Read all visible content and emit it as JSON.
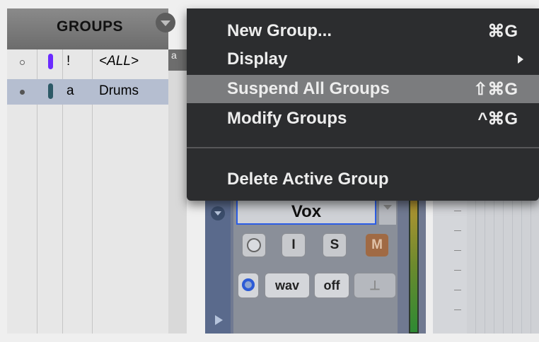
{
  "groups_panel": {
    "title": "GROUPS",
    "rows": [
      {
        "id": "!",
        "name": "<ALL>",
        "color": "#6b2bff",
        "selected": false
      },
      {
        "id": "a",
        "name": "Drums",
        "color": "#2d5a67",
        "selected": true
      }
    ],
    "stub_label": "a"
  },
  "context_menu": {
    "items": [
      {
        "label": "New Group...",
        "shortcut": "⌘G"
      },
      {
        "label": "Display",
        "shortcut": ""
      },
      {
        "label": "Suspend All Groups",
        "shortcut": "⇧⌘G"
      },
      {
        "label": "Modify Groups",
        "shortcut": "^⌘G"
      },
      {
        "label": "Delete Active Group",
        "shortcut": ""
      }
    ]
  },
  "track": {
    "name": "Vox",
    "buttons": {
      "record": "",
      "input": "I",
      "solo": "S",
      "mute": "M"
    },
    "format": "wav",
    "timebase": "off"
  },
  "colors": {
    "menu_bg": "#2c2d2f",
    "menu_highlight": "#7b7c7e",
    "selected_row": "#b5bed0",
    "track_name_border": "#2c5de5"
  }
}
